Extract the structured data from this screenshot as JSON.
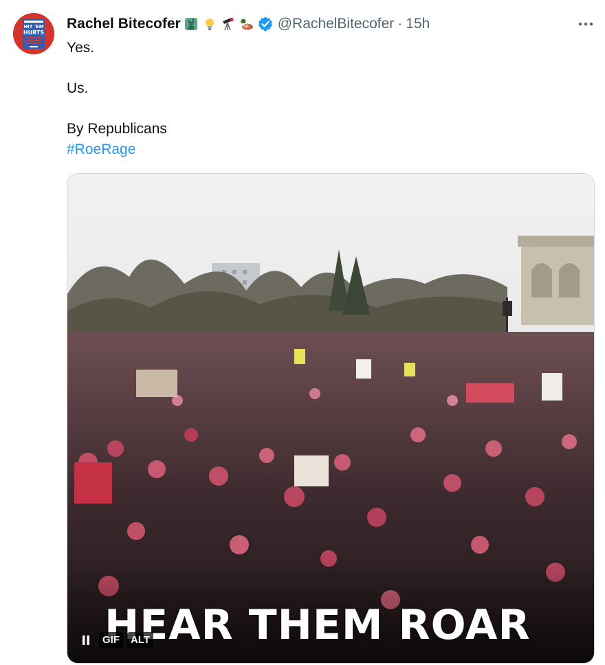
{
  "author": {
    "display_name": "Rachel Bitecofer",
    "name_emojis": [
      "statue-of-liberty",
      "lightbulb",
      "telescope",
      "duck"
    ],
    "verified": true,
    "handle": "@RachelBitecofer",
    "separator": "·",
    "time": "15h",
    "avatar_text": [
      "HIT 'EM",
      "HURTS"
    ]
  },
  "tweet": {
    "lines": [
      "Yes.",
      "",
      "Us.",
      "",
      "By Republicans"
    ],
    "hashtag": "#RoeRage"
  },
  "media": {
    "type": "gif",
    "caption": "HEAR THEM ROAR",
    "gif_badge": "GIF",
    "alt_badge": "ALT",
    "pause_icon": "pause-icon"
  },
  "colors": {
    "link": "#1d9bf0",
    "secondary_text": "#536471",
    "verified_badge": "#1d9bf0"
  }
}
